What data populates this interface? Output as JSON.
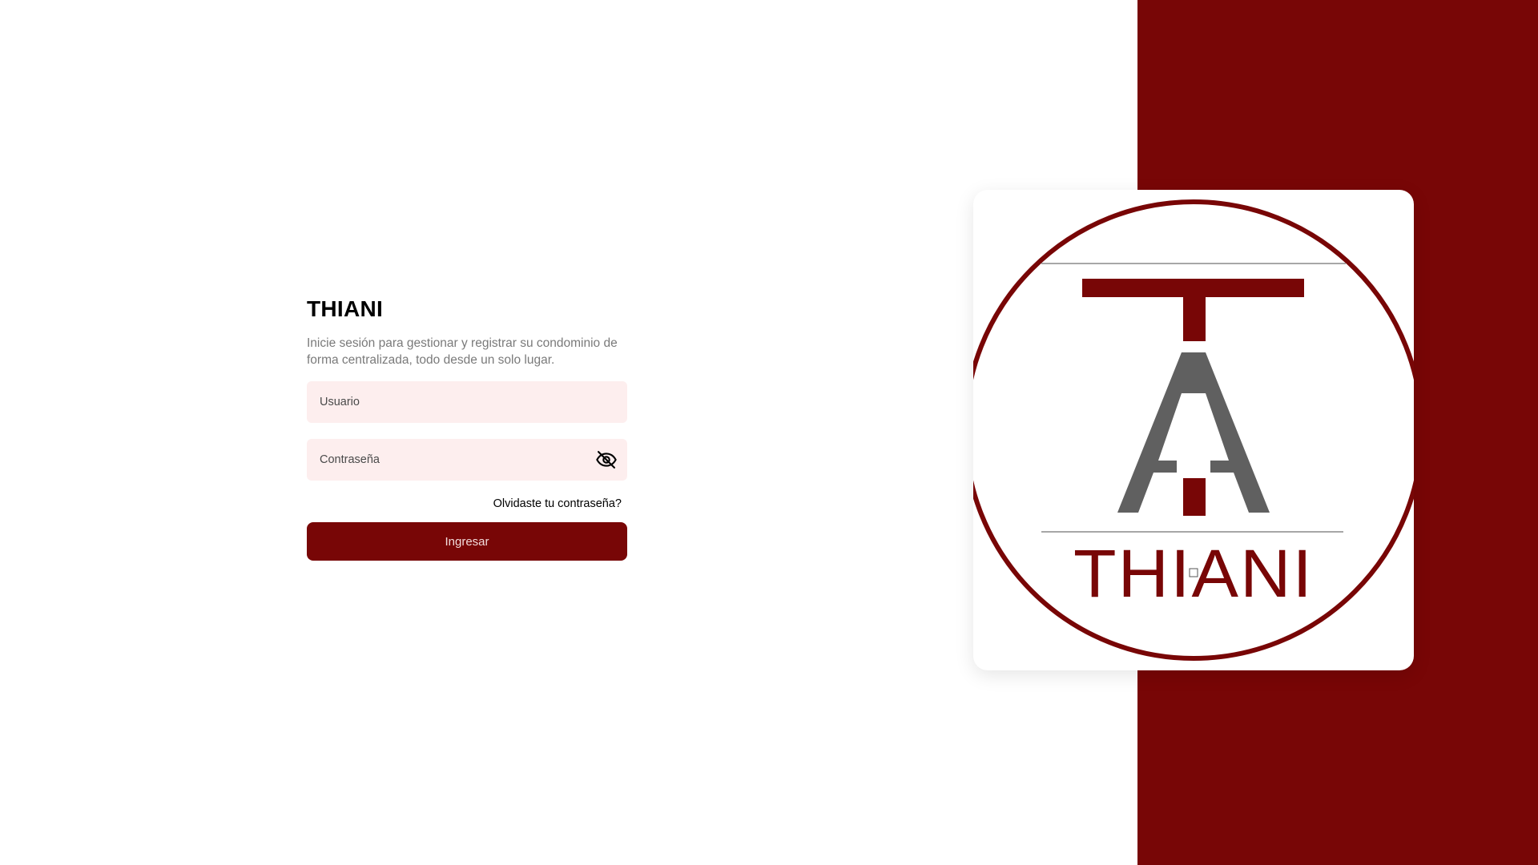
{
  "brand": {
    "title": "THIANI",
    "subtitle": "Inicie sesión para gestionar y registrar su condominio de forma centralizada, todo desde un solo lugar."
  },
  "form": {
    "username_placeholder": "Usuario",
    "username_value": "",
    "password_placeholder": "Contraseña",
    "password_value": "",
    "forgot_label": "Olvidaste tu contraseña?",
    "submit_label": "Ingresar",
    "password_toggle_icon": "eye-off-icon"
  },
  "logo": {
    "wordmark": "THIANI"
  },
  "colors": {
    "brand_primary": "#780606",
    "field_background": "#fdeeee",
    "logo_gray": "#606060"
  }
}
